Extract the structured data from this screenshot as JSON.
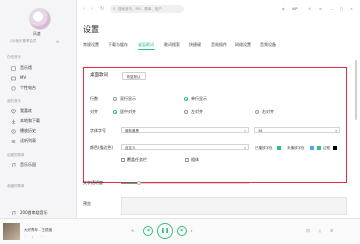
{
  "sidebar": {
    "username": "风速",
    "vip_text": "QQ音乐尊享会员",
    "sections": [
      {
        "label": "在线音乐",
        "items": [
          {
            "label": "音乐馆",
            "icon": "music-hall-icon"
          },
          {
            "label": "MV",
            "icon": "mv-icon"
          },
          {
            "label": "个性电台",
            "icon": "radio-icon"
          }
        ]
      },
      {
        "label": "我的音乐",
        "items": [
          {
            "label": "我喜欢",
            "icon": "heart-icon"
          },
          {
            "label": "本地和下载",
            "icon": "download-icon"
          },
          {
            "label": "播放历史",
            "icon": "history-icon"
          },
          {
            "label": "试听列表",
            "icon": "list-icon"
          }
        ]
      },
      {
        "label": "创建的歌单",
        "items": [
          {
            "label": "音乐乐园",
            "icon": "playlist-icon"
          }
        ]
      },
      {
        "label": "收藏的歌单",
        "items": [
          {
            "label": "200首串烧音乐",
            "icon": "playlist-icon"
          }
        ]
      }
    ]
  },
  "topbar": {
    "search_placeholder": "搜索音乐、MV、歌单、用户",
    "vip_label": "VIP"
  },
  "settings": {
    "title": "设置",
    "tabs": [
      "常规设置",
      "下载与缓存",
      "桌面歌词",
      "歌词搜索",
      "快捷键",
      "音效插件",
      "网络设置",
      "音频设备"
    ],
    "active_tab": 2,
    "panel_title": "桌面歌词",
    "restore_button": "恢复默认",
    "rows": {
      "lines_label": "行数",
      "lines_options": [
        "双行显示",
        "单行显示"
      ],
      "lines_selected": 1,
      "align_label": "对齐",
      "align_options": [
        "居中对齐",
        "左对齐",
        "右对齐"
      ],
      "align_selected": 0,
      "font_label": "字体字号",
      "font_value": "微软雅黑",
      "size_value": "36",
      "color_label": "颜色(描边色)",
      "color_value": "自定义",
      "played_color_label": "已播放字色",
      "unplayed_color_label": "未播放字色",
      "stroke_label": "边框",
      "bold_label": "粗体",
      "topmost_label": "覆盖任务栏",
      "opacity_label": "文字透明度",
      "preview_label": "预览"
    },
    "colors": {
      "played": "#31c27c",
      "unplayed": "#4aa8e8",
      "stroke": "#000000",
      "highlight": "#e03040"
    }
  },
  "player": {
    "song": "大好青年 - 王锐涵"
  }
}
